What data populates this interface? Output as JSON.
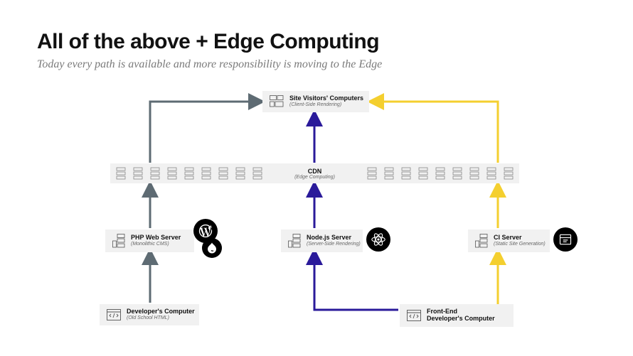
{
  "title": "All of the above + Edge Computing",
  "subtitle": "Today every path is available and more responsibility is moving to the Edge",
  "nodes": {
    "visitors": {
      "label": "Site Visitors' Computers",
      "sub": "(Client-Side Rendering)"
    },
    "cdn": {
      "label": "CDN",
      "sub": "(Edge Computing)"
    },
    "php": {
      "label": "PHP Web Server",
      "sub": "(Monolithic CMS)"
    },
    "node": {
      "label": "Node.js Server",
      "sub": "(Server-Side Rendering)"
    },
    "ci": {
      "label": "CI Server",
      "sub": "(Static Site Generation)"
    },
    "dev": {
      "label": "Developer's Computer",
      "sub": "(Old School HTML)"
    },
    "fedev": {
      "label": "Front-End",
      "label2": "Developer's Computer"
    }
  },
  "badges": {
    "wordpress": "wordpress-icon",
    "drupal": "drupal-icon",
    "react": "react-icon",
    "site": "browser-icon"
  },
  "colors": {
    "gray": "#5e6b73",
    "blue": "#2a1a9a",
    "yellow": "#f4cf2f"
  }
}
